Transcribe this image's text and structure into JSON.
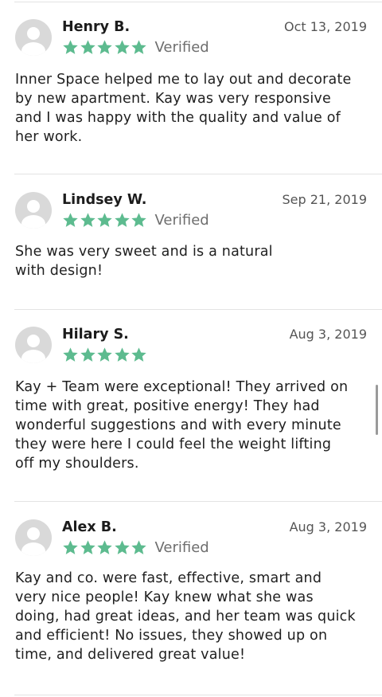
{
  "colors": {
    "star": "#5dbb8f",
    "avatar": "#d9d9d9"
  },
  "reviews": [
    {
      "name": "Henry B.",
      "date": "Oct 13, 2019",
      "rating": 5,
      "verified": "Verified",
      "text": "Inner Space helped me to lay out and decorate\nby new apartment. Kay was very responsive\nand I was happy with the quality and value of\nher work."
    },
    {
      "name": "Lindsey W.",
      "date": "Sep 21, 2019",
      "rating": 5,
      "verified": "Verified",
      "text": "She was very sweet and is a natural\nwith design!"
    },
    {
      "name": "Hilary S.",
      "date": "Aug 3, 2019",
      "rating": 5,
      "verified": "",
      "text": "Kay + Team were exceptional! They arrived on\ntime with great, positive energy! They had\nwonderful suggestions and with every minute\nthey were here I could feel the weight lifting\noff my shoulders."
    },
    {
      "name": "Alex B.",
      "date": "Aug 3, 2019",
      "rating": 5,
      "verified": "Verified",
      "text": "Kay and co. were fast, effective, smart and\nvery nice people! Kay knew what she was\ndoing, had great ideas, and her team was quick\nand efficient! No issues, they showed up on\ntime, and delivered great value!"
    }
  ]
}
